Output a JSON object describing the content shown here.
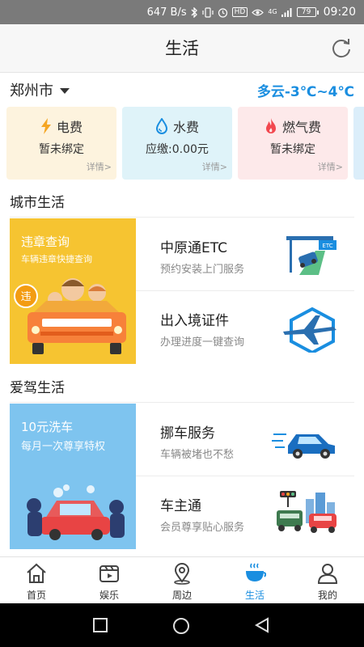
{
  "status_bar": {
    "net_speed": "647 B/s",
    "battery": "79",
    "time": "09:20",
    "icons": [
      "bluetooth-icon",
      "vibrate-icon",
      "alarm-icon",
      "hd-icon",
      "eye-icon",
      "4g-icon",
      "signal-icon",
      "battery-icon"
    ],
    "hd_label": "HD",
    "net_type": "4G"
  },
  "header": {
    "title": "生活",
    "refresh_icon": "refresh-icon"
  },
  "location": {
    "city": "郑州市",
    "weather": "多云-3℃~4℃"
  },
  "utility_cards": [
    {
      "name": "电费",
      "status": "暂未绑定",
      "detail": "详情>",
      "icon": "lightning-icon",
      "color": "#f5a623"
    },
    {
      "name": "水费",
      "status": "应缴:0.00元",
      "detail": "详情>",
      "icon": "water-drop-icon",
      "color": "#1a8ee0"
    },
    {
      "name": "燃气费",
      "status": "暂未绑定",
      "detail": "详情>",
      "icon": "flame-icon",
      "color": "#f2484f"
    }
  ],
  "city_life": {
    "title": "城市生活",
    "banner": {
      "title": "违章查询",
      "subtitle": "车辆违章快捷查询",
      "badge": "违"
    },
    "items": [
      {
        "title": "中原通ETC",
        "subtitle": "预约安装上门服务",
        "icon": "etc-icon",
        "badge": "ETC"
      },
      {
        "title": "出入境证件",
        "subtitle": "办理进度一键查询",
        "icon": "airplane-icon"
      }
    ]
  },
  "driving_life": {
    "title": "爱驾生活",
    "banner": {
      "title": "10元洗车",
      "subtitle": "每月一次尊享特权"
    },
    "items": [
      {
        "title": "挪车服务",
        "subtitle": "车辆被堵也不愁",
        "icon": "blue-car-icon"
      },
      {
        "title": "车主通",
        "subtitle": "会员尊享贴心服务",
        "icon": "traffic-icon"
      }
    ]
  },
  "bottom_nav": [
    {
      "label": "首页",
      "icon": "home-icon",
      "active": false
    },
    {
      "label": "娱乐",
      "icon": "video-icon",
      "active": false
    },
    {
      "label": "周边",
      "icon": "location-pin-icon",
      "active": false
    },
    {
      "label": "生活",
      "icon": "coffee-cup-icon",
      "active": true
    },
    {
      "label": "我的",
      "icon": "person-icon",
      "active": false
    }
  ],
  "colors": {
    "accent": "#1a8ee0",
    "status_bar": "#7a7a7a",
    "banner_yellow": "#f6c431",
    "banner_blue": "#7ec4ef"
  }
}
